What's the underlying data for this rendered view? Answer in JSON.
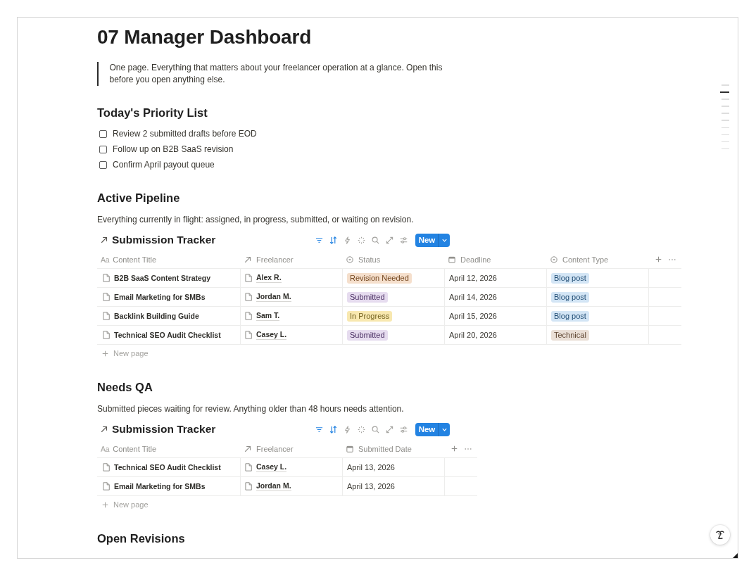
{
  "page": {
    "title": "07 Manager Dashboard",
    "quote": "One page. Everything that matters about your freelancer operation at a glance. Open this before you open anything else."
  },
  "priority_list": {
    "heading": "Today's Priority List",
    "items": [
      {
        "label": "Review 2 submitted drafts before EOD",
        "checked": false
      },
      {
        "label": "Follow up on B2B SaaS revision",
        "checked": false
      },
      {
        "label": "Confirm April payout queue",
        "checked": false
      }
    ]
  },
  "sections": [
    {
      "heading": "Active Pipeline",
      "description": "Everything currently in flight: assigned, in progress, submitted, or waiting on revision.",
      "database": {
        "title": "Submission Tracker",
        "toolbar": [
          {
            "kind": "filter",
            "active": true
          },
          {
            "kind": "sort",
            "active": true
          },
          {
            "kind": "automation",
            "active": false
          },
          {
            "kind": "sparkle",
            "active": false
          },
          {
            "kind": "search",
            "active": false
          },
          {
            "kind": "expand",
            "active": false
          },
          {
            "kind": "sliders",
            "active": false
          }
        ],
        "new_button": "New",
        "columns": [
          {
            "label": "Content Title",
            "kind": "title",
            "glyph": "Aa"
          },
          {
            "label": "Freelancer",
            "kind": "relation"
          },
          {
            "label": "Status",
            "kind": "status"
          },
          {
            "label": "Deadline",
            "kind": "date"
          },
          {
            "label": "Content Type",
            "kind": "select"
          }
        ],
        "rows": [
          [
            {
              "text": "B2B SaaS Content Strategy"
            },
            {
              "text": "Alex R."
            },
            {
              "text": "Revision Needed",
              "color": "#f5dfcc"
            },
            {
              "text": "April 12, 2026"
            },
            {
              "text": "Blog post",
              "color": "#d3e5f5"
            }
          ],
          [
            {
              "text": "Email Marketing for SMBs"
            },
            {
              "text": "Jordan M."
            },
            {
              "text": "Submitted",
              "color": "#e6dcef"
            },
            {
              "text": "April 14, 2026"
            },
            {
              "text": "Blog post",
              "color": "#d3e5f5"
            }
          ],
          [
            {
              "text": "Backlink Building Guide"
            },
            {
              "text": "Sam T."
            },
            {
              "text": "In Progress",
              "color": "#f8e8b0"
            },
            {
              "text": "April 15, 2026"
            },
            {
              "text": "Blog post",
              "color": "#d3e5f5"
            }
          ],
          [
            {
              "text": "Technical SEO Audit Checklist"
            },
            {
              "text": "Casey L."
            },
            {
              "text": "Submitted",
              "color": "#e6dcef"
            },
            {
              "text": "April 20, 2026"
            },
            {
              "text": "Technical",
              "color": "#eadfd6"
            }
          ]
        ],
        "new_page": "New page"
      }
    },
    {
      "heading": "Needs QA",
      "description": "Submitted pieces waiting for review. Anything older than 48 hours needs attention.",
      "database": {
        "title": "Submission Tracker",
        "toolbar": [
          {
            "kind": "filter",
            "active": true
          },
          {
            "kind": "sort",
            "active": true
          },
          {
            "kind": "automation",
            "active": false
          },
          {
            "kind": "sparkle",
            "active": false
          },
          {
            "kind": "search",
            "active": false
          },
          {
            "kind": "expand",
            "active": false
          },
          {
            "kind": "sliders",
            "active": false
          }
        ],
        "new_button": "New",
        "columns": [
          {
            "label": "Content Title",
            "kind": "title",
            "glyph": "Aa"
          },
          {
            "label": "Freelancer",
            "kind": "relation"
          },
          {
            "label": "Submitted Date",
            "kind": "date"
          }
        ],
        "rows": [
          [
            {
              "text": "Technical SEO Audit Checklist"
            },
            {
              "text": "Casey L."
            },
            {
              "text": "April 13, 2026"
            }
          ],
          [
            {
              "text": "Email Marketing for SMBs"
            },
            {
              "text": "Jordan M."
            },
            {
              "text": "April 13, 2026"
            }
          ]
        ],
        "new_page": "New page"
      }
    },
    {
      "heading": "Open Revisions"
    }
  ],
  "outline_markers": [
    {
      "selected": false
    },
    {
      "selected": true
    },
    {
      "selected": false
    },
    {
      "selected": false
    },
    {
      "selected": false
    },
    {
      "selected": false
    },
    {
      "selected": false
    },
    {
      "selected": false
    },
    {
      "selected": false
    },
    {
      "selected": false
    }
  ]
}
